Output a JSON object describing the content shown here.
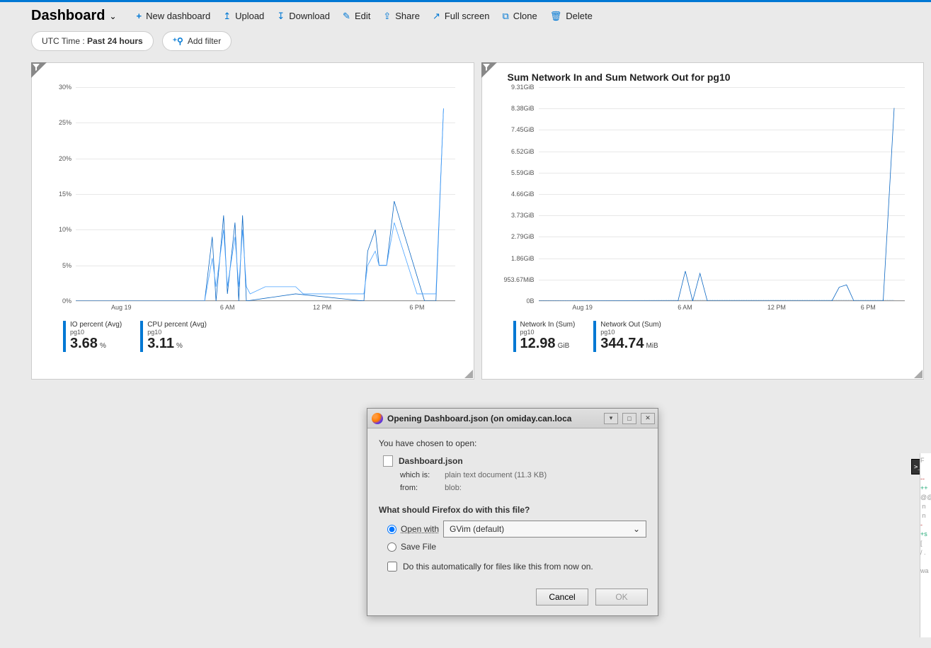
{
  "toolbar": {
    "title": "Dashboard",
    "new_dashboard": "New dashboard",
    "upload": "Upload",
    "download": "Download",
    "edit": "Edit",
    "share": "Share",
    "full_screen": "Full screen",
    "clone": "Clone",
    "delete": "Delete"
  },
  "filters": {
    "time_label": "UTC Time :",
    "time_value": "Past 24 hours",
    "add_filter": "Add filter"
  },
  "panel1": {
    "title": "",
    "legend1": {
      "label": "IO percent (Avg)",
      "sub": "pg10",
      "value": "3.68",
      "unit": "%"
    },
    "legend2": {
      "label": "CPU percent (Avg)",
      "sub": "pg10",
      "value": "3.11",
      "unit": "%"
    }
  },
  "panel2": {
    "title": "Sum Network In and Sum Network Out for pg10",
    "legend1": {
      "label": "Network In (Sum)",
      "sub": "pg10",
      "value": "12.98",
      "unit": "GiB"
    },
    "legend2": {
      "label": "Network Out (Sum)",
      "sub": "pg10",
      "value": "344.74",
      "unit": "MiB"
    }
  },
  "dialog": {
    "title": "Opening Dashboard.json (on omiday.can.loca",
    "prompt": "You have chosen to open:",
    "filename": "Dashboard.json",
    "which_is_label": "which is:",
    "which_is_value": "plain text document (11.3 KB)",
    "from_label": "from:",
    "from_value": "blob:",
    "question": "What should Firefox do with this file?",
    "open_with": "Open with",
    "open_app": "GVim (default)",
    "save_file": "Save File",
    "auto_label": "Do this automatically for files like this from now on.",
    "cancel": "Cancel",
    "ok": "OK"
  },
  "chart_data": [
    {
      "type": "line",
      "title": "",
      "ylabel": "%",
      "xlabel": "",
      "ylim": [
        0,
        30
      ],
      "y_ticks": [
        "0%",
        "5%",
        "10%",
        "15%",
        "20%",
        "25%",
        "30%"
      ],
      "x_ticks": [
        "Aug 19",
        "6 AM",
        "12 PM",
        "6 PM"
      ],
      "series": [
        {
          "name": "IO percent (Avg)",
          "color": "#0a66c2",
          "points": [
            [
              0,
              0
            ],
            [
              34,
              0
            ],
            [
              36,
              9
            ],
            [
              37,
              0
            ],
            [
              39,
              12
            ],
            [
              40,
              1
            ],
            [
              42,
              11
            ],
            [
              43,
              0
            ],
            [
              44,
              12
            ],
            [
              45,
              0
            ],
            [
              58,
              1
            ],
            [
              76,
              0
            ],
            [
              77,
              7
            ],
            [
              79,
              10
            ],
            [
              80,
              5
            ],
            [
              82,
              5
            ],
            [
              84,
              14
            ],
            [
              92,
              0
            ],
            [
              95,
              0
            ],
            [
              97,
              27
            ]
          ]
        },
        {
          "name": "CPU percent (Avg)",
          "color": "#4aa3ff",
          "points": [
            [
              0,
              0
            ],
            [
              34,
              0
            ],
            [
              36,
              6
            ],
            [
              37,
              2
            ],
            [
              39,
              10
            ],
            [
              40,
              2
            ],
            [
              42,
              9
            ],
            [
              43,
              2
            ],
            [
              44,
              10
            ],
            [
              45,
              2
            ],
            [
              46,
              1
            ],
            [
              50,
              2
            ],
            [
              58,
              2
            ],
            [
              60,
              1
            ],
            [
              76,
              1
            ],
            [
              77,
              5
            ],
            [
              79,
              7
            ],
            [
              80,
              5
            ],
            [
              82,
              5
            ],
            [
              84,
              11
            ],
            [
              90,
              1
            ],
            [
              92,
              1
            ],
            [
              95,
              1
            ],
            [
              97,
              27
            ]
          ]
        }
      ]
    },
    {
      "type": "line",
      "title": "Sum Network In and Sum Network Out for pg10",
      "ylabel": "",
      "xlabel": "",
      "y_ticks": [
        "0B",
        "953.67MiB",
        "1.86GiB",
        "2.79GiB",
        "3.73GiB",
        "4.66GiB",
        "5.59GiB",
        "6.52GiB",
        "7.45GiB",
        "8.38GiB",
        "9.31GiB"
      ],
      "x_ticks": [
        "Aug 19",
        "6 AM",
        "12 PM",
        "6 PM"
      ],
      "series": [
        {
          "name": "Network In (Sum)",
          "color": "#0a66c2",
          "points": [
            [
              0,
              0
            ],
            [
              38,
              0
            ],
            [
              40,
              1.3
            ],
            [
              42,
              0
            ],
            [
              44,
              1.2
            ],
            [
              46,
              0
            ],
            [
              80,
              0
            ],
            [
              82,
              0.6
            ],
            [
              84,
              0.7
            ],
            [
              86,
              0
            ],
            [
              94,
              0
            ],
            [
              97,
              8.4
            ]
          ]
        },
        {
          "name": "Network Out (Sum)",
          "color": "#4aa3ff",
          "dashed": true,
          "points": [
            [
              0,
              0
            ],
            [
              50,
              0.05
            ],
            [
              97,
              0.05
            ]
          ]
        }
      ]
    }
  ]
}
